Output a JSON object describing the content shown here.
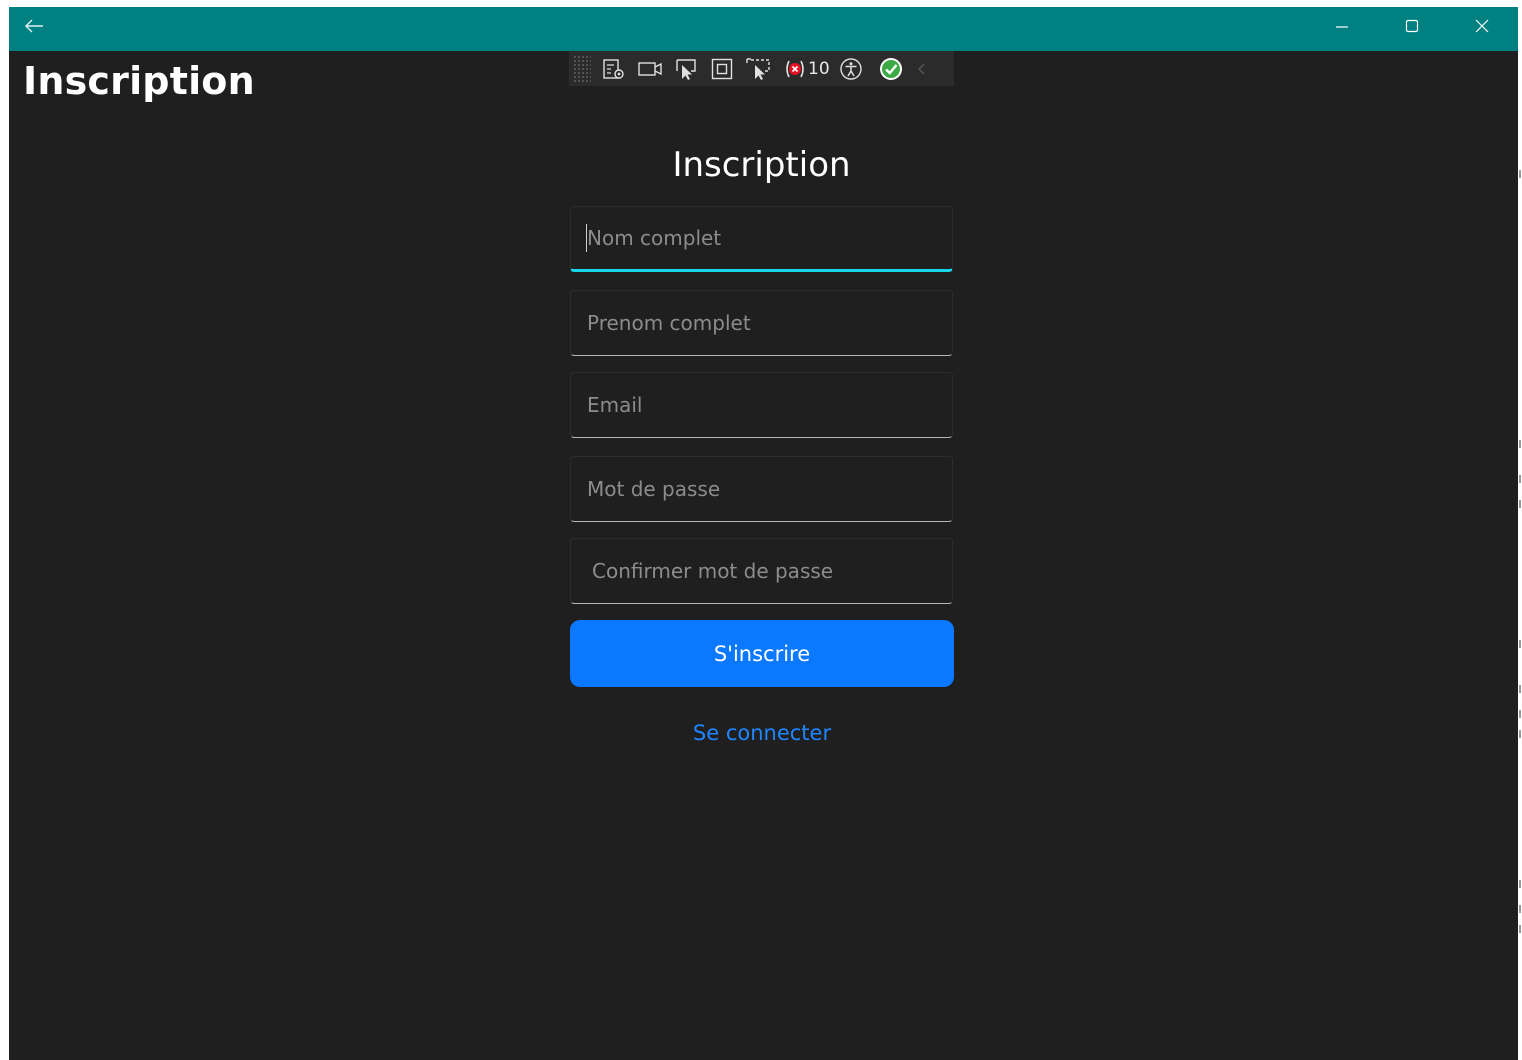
{
  "window": {
    "titlebar_color": "#008080",
    "background_color": "#1f1f1f",
    "controls": {
      "back": "arrow-left-icon",
      "minimize": "minimize-icon",
      "maximize": "maximize-icon",
      "close": "close-icon"
    }
  },
  "page": {
    "header": "Inscription"
  },
  "dev_toolbar": {
    "icons": [
      "live-visual-tree-icon",
      "camera-icon",
      "select-element-icon",
      "display-layout-adorners-icon",
      "track-focus-icon",
      "binding-failures-icon",
      "accessibility-icon",
      "hot-reload-ok-icon",
      "chevron-left-icon"
    ],
    "binding_failures_count": "10"
  },
  "form": {
    "title": "Inscription",
    "fields": {
      "nom": {
        "placeholder": "Nom complet",
        "value": ""
      },
      "prenom": {
        "placeholder": "Prenom complet",
        "value": ""
      },
      "email": {
        "placeholder": "Email",
        "value": ""
      },
      "password": {
        "placeholder": "Mot de passe",
        "value": ""
      },
      "confirm_password": {
        "placeholder": "Confirmer mot de passe",
        "value": ""
      }
    },
    "submit_label": "S'inscrire",
    "login_link": "Se connecter",
    "accent_color": "#0a78ff",
    "focus_color": "#15d6e8",
    "link_color": "#1e86ff"
  }
}
